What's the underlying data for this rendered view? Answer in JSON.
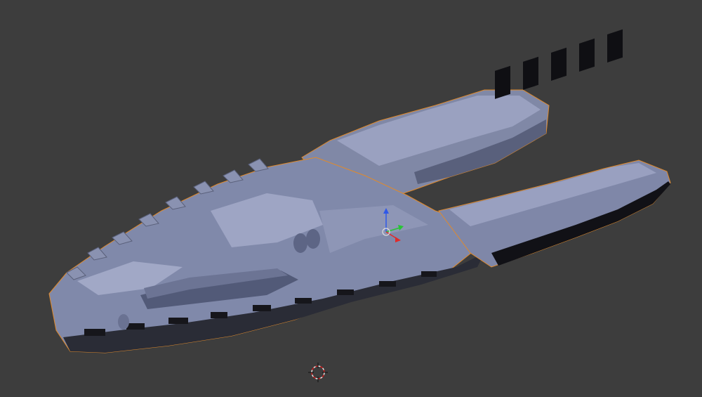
{
  "viewport": {
    "background_color": "#3d3d3d",
    "selection_outline_color": "#e08a2c"
  },
  "model": {
    "object": "spaceship-mesh",
    "base_color": "#7f87aa",
    "light_color": "#a4abc8",
    "dark_color": "#4c5370",
    "shadow_color": "#101013"
  },
  "gizmo": {
    "axis_z_color": "#2f58e8",
    "axis_y_color": "#27c535",
    "axis_x_color": "#e02a2a"
  },
  "cursor_3d": {
    "ring_color_a": "#e8e8e8",
    "ring_color_b": "#c81e1e"
  }
}
